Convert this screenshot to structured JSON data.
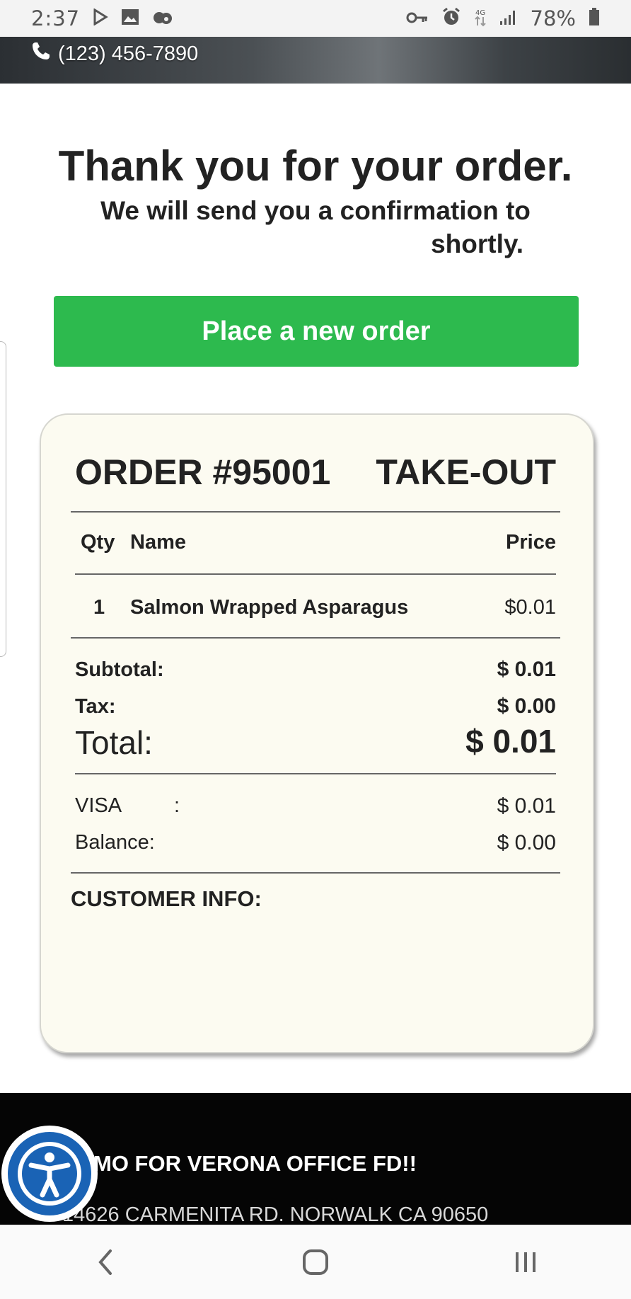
{
  "status_bar": {
    "time": "2:37",
    "battery_percent": "78%",
    "icons": [
      "play-icon",
      "image-icon",
      "cloud-icon",
      "key-icon",
      "alarm-icon",
      "data-icon",
      "signal-icon",
      "battery-icon"
    ]
  },
  "header": {
    "phone": "(123) 456-7890"
  },
  "confirmation": {
    "title": "Thank you for your order.",
    "subtitle_line1": "We will send you a confirmation to",
    "subtitle_line2": "shortly.",
    "new_order_button": "Place a new order"
  },
  "receipt": {
    "order_number": "ORDER #95001",
    "order_type": "TAKE-OUT",
    "columns": {
      "qty": "Qty",
      "name": "Name",
      "price": "Price"
    },
    "items": [
      {
        "qty": "1",
        "name": "Salmon Wrapped Asparagus",
        "price": "$0.01"
      }
    ],
    "subtotal_label": "Subtotal:",
    "subtotal_value": "$ 0.01",
    "tax_label": "Tax:",
    "tax_value": "$ 0.00",
    "total_label": "Total:",
    "total_value": "$ 0.01",
    "payment_label": "VISA",
    "payment_colon": ":",
    "payment_value": "$ 0.01",
    "balance_label": "Balance:",
    "balance_value": "$ 0.00",
    "customer_info_label": "CUSTOMER INFO:"
  },
  "footer": {
    "promo": "MO FOR VERONA OFFICE FD!!",
    "address": "14626 CARMENITA RD. NORWALK CA 90650"
  },
  "colors": {
    "button_green": "#2dba4e",
    "receipt_bg": "#fcfbf1",
    "accessibility_blue": "#1a63b5",
    "footer_bg": "#050505"
  }
}
